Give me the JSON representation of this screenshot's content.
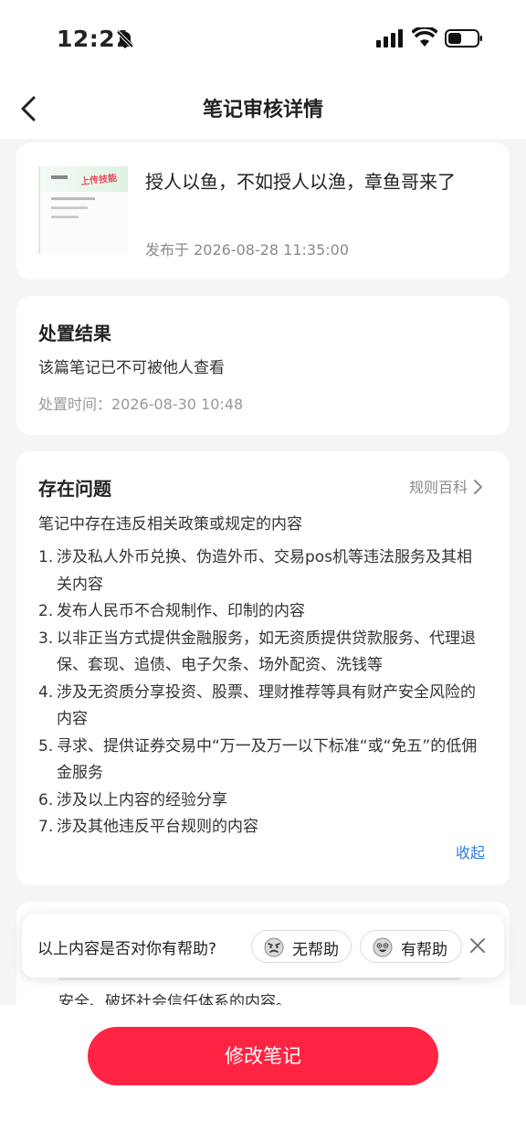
{
  "status_bar": {
    "time": "12:21"
  },
  "nav": {
    "title": "笔记审核详情"
  },
  "note": {
    "title": "授人以鱼，不如授人以渔，章鱼哥来了",
    "published": "发布于 2026-08-28 11:35:00",
    "thumb_tag": "上传技能"
  },
  "result": {
    "heading": "处置结果",
    "text": "该篇笔记已不可被他人查看",
    "time": "处置时间：2026-08-30 10:48"
  },
  "issues": {
    "heading": "存在问题",
    "rules_link": "规则百科",
    "summary": "笔记中存在违反相关政策或规定的内容",
    "items": [
      {
        "num": "1.",
        "text": "涉及私人外币兑换、伪造外币、交易pos机等违法服务及其相关内容"
      },
      {
        "num": "2.",
        "text": "发布人民币不合规制作、印制的内容"
      },
      {
        "num": "3.",
        "text": "以非正当方式提供金融服务，如无资质提供贷款服务、代理退保、套现、追债、电子欠条、场外配资、洗钱等"
      },
      {
        "num": "4.",
        "text": "涉及无资质分享投资、股票、理财推荐等具有财产安全风险的内容"
      },
      {
        "num": "5.",
        "text": "寻求、提供证券交易中“万一及万一以下标准“或“免五”的低佣金服务"
      },
      {
        "num": "6.",
        "text": "涉及以上内容的经验分享"
      },
      {
        "num": "7.",
        "text": "涉及其他违反平台规则的内容"
      }
    ],
    "collapse": "收起"
  },
  "more_card": {
    "peek_text": "安全、破坏社会信任体系的内容。"
  },
  "feedback": {
    "question": "以上内容是否对你有帮助?",
    "no_label": "无帮助",
    "yes_label": "有帮助"
  },
  "bottom": {
    "edit_button": "修改笔记"
  },
  "colors": {
    "accent": "#ff2442",
    "link": "#2f7fe0"
  }
}
